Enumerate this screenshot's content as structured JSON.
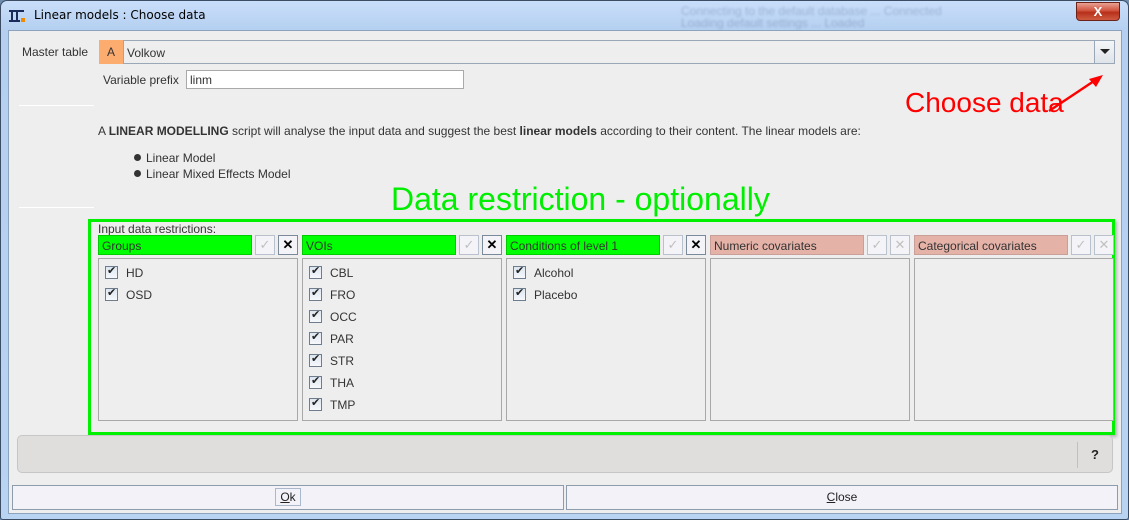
{
  "window": {
    "title": "Linear models :  Choose data",
    "close_label": "X",
    "background_text": [
      "Connecting to the default database ... Connected",
      "Loading default settings ... Loaded"
    ]
  },
  "master_table": {
    "label": "Master table",
    "badge": "A",
    "value": "Volkow"
  },
  "variable_prefix": {
    "label": "Variable prefix",
    "value": "linm"
  },
  "description": {
    "prefix": "A ",
    "bold1": "LINEAR MODELLING",
    "middle": " script will analyse the input data and suggest the best ",
    "bold2": "linear models",
    "suffix": " according to their content. The linear models are:",
    "models": [
      "Linear Model",
      "Linear Mixed Effects Model"
    ]
  },
  "annotations": {
    "choose_data": "Choose data",
    "data_restriction": "Data restriction - optionally",
    "red": "#ff0000",
    "green": "#00ee00"
  },
  "restrictions": {
    "title": "Input data restrictions:",
    "columns": [
      {
        "header": "Groups",
        "active": true,
        "items": [
          "HD",
          "OSD"
        ]
      },
      {
        "header": "VOIs",
        "active": true,
        "items": [
          "CBL",
          "FRO",
          "OCC",
          "PAR",
          "STR",
          "THA",
          "TMP"
        ]
      },
      {
        "header": "Conditions of level 1",
        "active": true,
        "items": [
          "Alcohol",
          "Placebo"
        ]
      },
      {
        "header": "Numeric covariates",
        "active": false,
        "items": []
      },
      {
        "header": "Categorical covariates",
        "active": false,
        "items": []
      }
    ],
    "check_all_glyph": "✓",
    "clear_glyph": "✕"
  },
  "status": {
    "help_label": "?"
  },
  "buttons": {
    "ok_accel": "O",
    "ok_rest": "k",
    "close_accel": "C",
    "close_rest": "lose"
  }
}
